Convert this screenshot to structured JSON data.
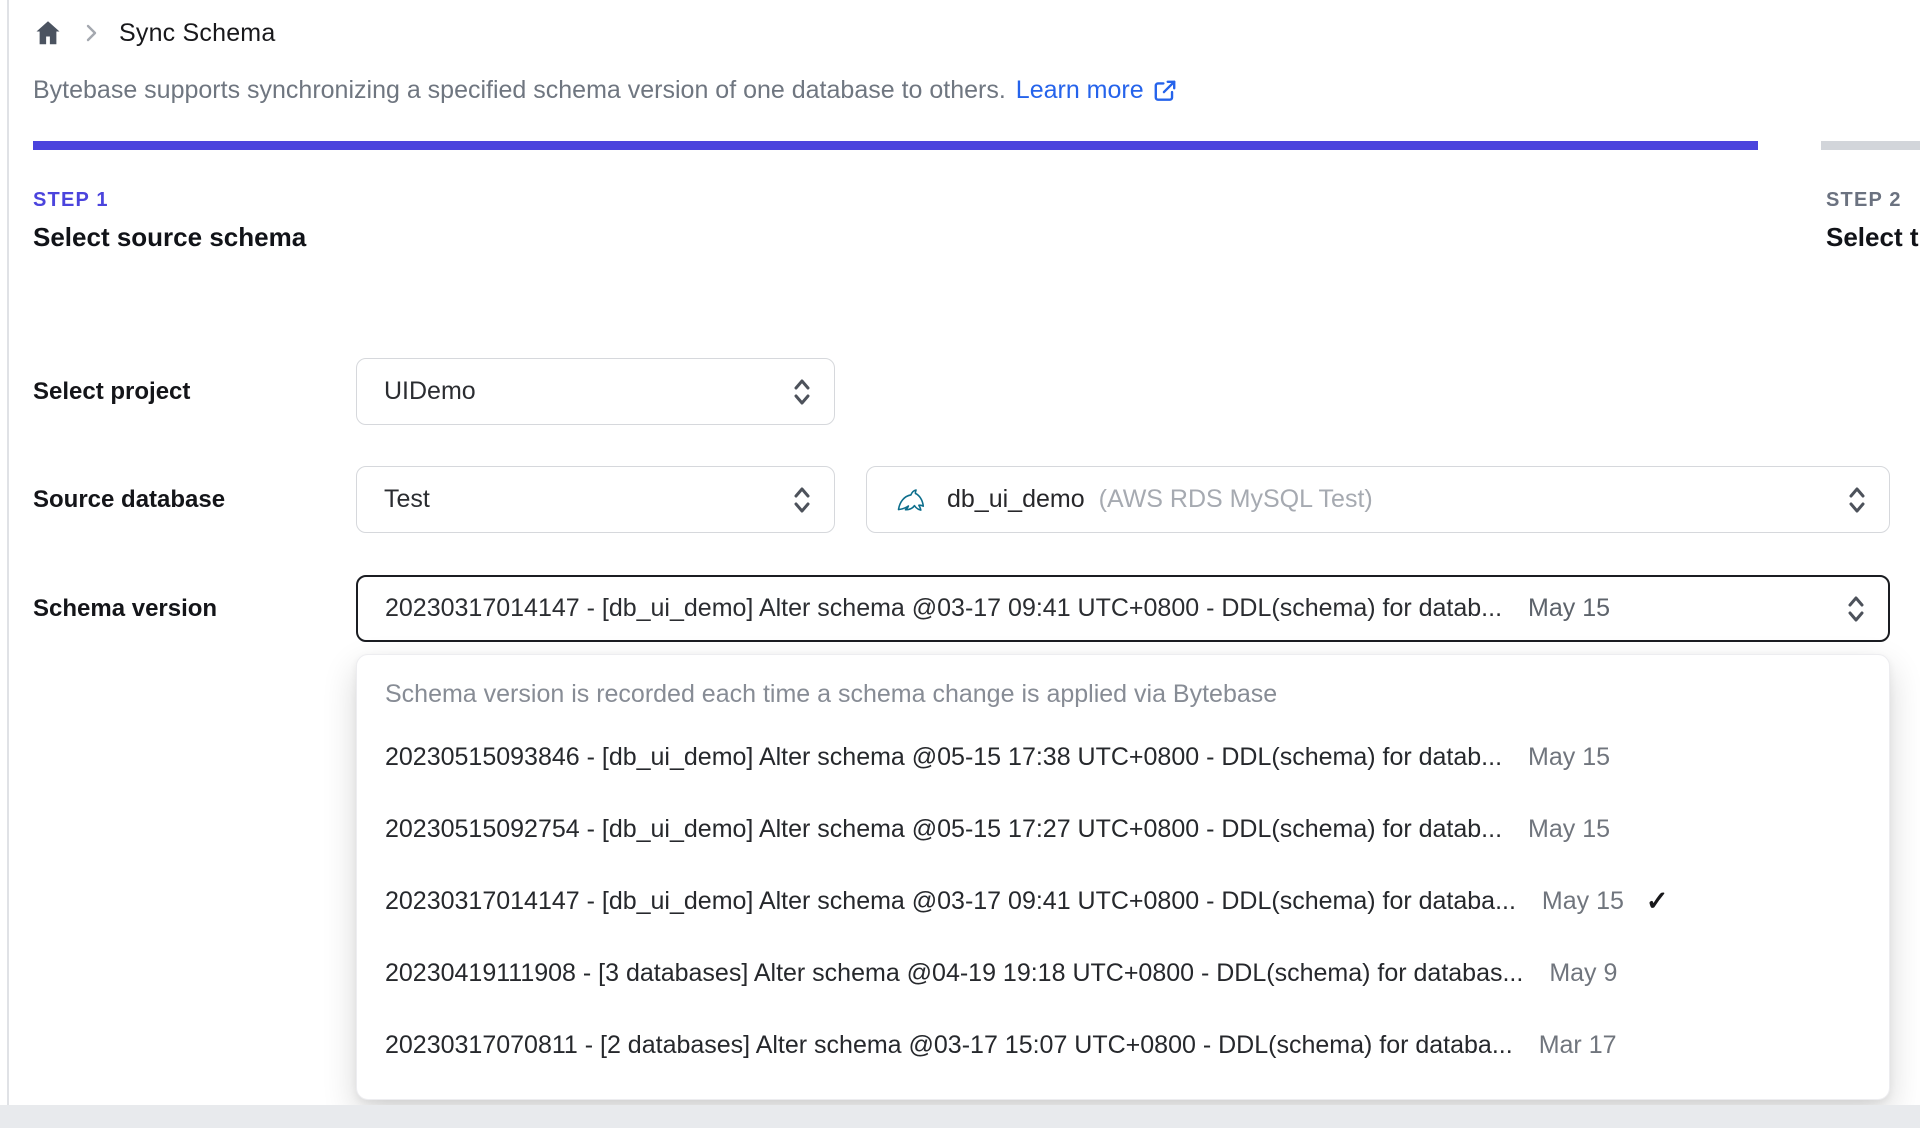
{
  "breadcrumb": {
    "title": "Sync Schema"
  },
  "intro": {
    "text": "Bytebase supports synchronizing a specified schema version of one database to others.",
    "link_label": "Learn more"
  },
  "steps": [
    {
      "step": "STEP 1",
      "title": "Select source schema",
      "active": true
    },
    {
      "step": "STEP 2",
      "title": "Select t",
      "active": false
    }
  ],
  "form": {
    "project": {
      "label": "Select project",
      "value": "UIDemo"
    },
    "source_database": {
      "label": "Source database",
      "environment_value": "Test",
      "database_value": "db_ui_demo",
      "database_detail": "(AWS RDS MySQL Test)"
    },
    "schema_version": {
      "label": "Schema version",
      "value": "20230317014147 - [db_ui_demo] Alter schema @03-17 09:41 UTC+0800 - DDL(schema) for datab...",
      "date": "May 15"
    }
  },
  "dropdown": {
    "hint": "Schema version is recorded each time a schema change is applied via Bytebase",
    "check_icon": "✓",
    "options": [
      {
        "text": "20230515093846 - [db_ui_demo] Alter schema @05-15 17:38 UTC+0800 - DDL(schema) for datab...",
        "date": "May 15",
        "selected": false
      },
      {
        "text": "20230515092754 - [db_ui_demo] Alter schema @05-15 17:27 UTC+0800 - DDL(schema) for datab...",
        "date": "May 15",
        "selected": false
      },
      {
        "text": "20230317014147 - [db_ui_demo] Alter schema @03-17 09:41 UTC+0800 - DDL(schema) for databa...",
        "date": "May 15",
        "selected": true
      },
      {
        "text": "20230419111908 - [3 databases] Alter schema @04-19 19:18 UTC+0800 - DDL(schema) for databas...",
        "date": "May 9",
        "selected": false
      },
      {
        "text": "20230317070811 - [2 databases] Alter schema @03-17 15:07 UTC+0800 - DDL(schema) for databa...",
        "date": "Mar 17",
        "selected": false
      }
    ]
  },
  "colors": {
    "accent_indigo": "#4b44dd",
    "link_blue": "#2563eb",
    "progress_inactive": "#d2d5da",
    "focus_border": "#1b1d22",
    "mysql_teal": "#0d6e8c"
  }
}
